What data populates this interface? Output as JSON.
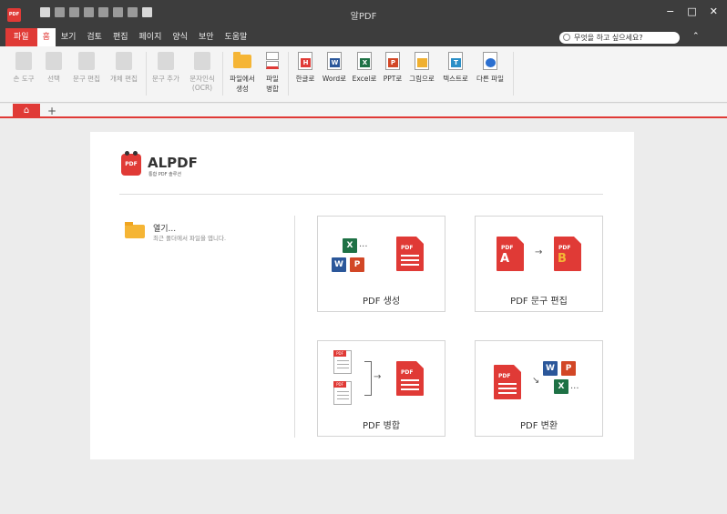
{
  "titlebar": {
    "logo": "PDF",
    "title": "알PDF",
    "minimize": "−",
    "maximize": "□",
    "close": "✕"
  },
  "menu": {
    "items": [
      "파일",
      "홈",
      "보기",
      "검토",
      "편집",
      "페이지",
      "양식",
      "보안",
      "도움말"
    ],
    "active": "홈",
    "search_placeholder": "무엇을 하고 싶으세요?",
    "collapse": "⌃"
  },
  "ribbon": {
    "hand_tool": "손 도구",
    "select": "선택",
    "text_edit": "문구 편집",
    "object_edit": "개체 편집",
    "add_text": "문구 추가",
    "ocr_line1": "문자인식",
    "ocr_line2": "(OCR)",
    "create_line1": "파일에서",
    "create_line2": "생성",
    "merge_line1": "파일",
    "merge_line2": "병합",
    "to_hangul": "한글로",
    "to_word": "Word로",
    "to_excel": "Excel로",
    "to_ppt": "PPT로",
    "to_image": "그림으로",
    "to_text": "텍스트로",
    "to_other": "다른 파일",
    "badge_h": "H",
    "badge_w": "W",
    "badge_x": "X",
    "badge_p": "P",
    "badge_t": "T"
  },
  "tabs": {
    "home": "⌂",
    "new": "+"
  },
  "start": {
    "brand_name": "ALPDF",
    "brand_sub": "통합 PDF 솔루션",
    "brand_icon": "PDF",
    "open_title": "열기...",
    "open_sub": "최근 폴더에서 파일을 엽니다.",
    "tiles": {
      "create": "PDF 생성",
      "edit": "PDF 문구 편집",
      "merge": "PDF 병합",
      "convert": "PDF 변환"
    },
    "pdf_tag": "PDF",
    "letter_a": "A",
    "letter_b": "B",
    "ellipsis": "..."
  },
  "colors": {
    "accent": "#e03a36",
    "excel": "#1e7145",
    "word": "#2b579a",
    "ppt": "#d24726",
    "folder": "#f5b535"
  }
}
